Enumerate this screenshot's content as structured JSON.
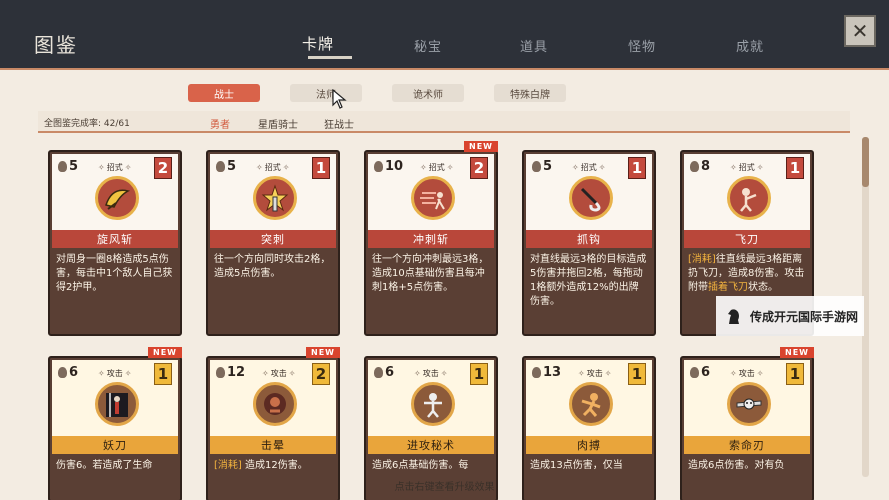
{
  "header": {
    "title": "图鉴",
    "tabs": [
      {
        "label": "卡牌",
        "active": true
      },
      {
        "label": "秘宝",
        "active": false
      },
      {
        "label": "道具",
        "active": false
      },
      {
        "label": "怪物",
        "active": false
      },
      {
        "label": "成就",
        "active": false
      }
    ],
    "close_label": "✕"
  },
  "class_tabs": [
    {
      "label": "战士",
      "active": true
    },
    {
      "label": "法师",
      "active": false
    },
    {
      "label": "诡术师",
      "active": false
    },
    {
      "label": "特殊白牌",
      "active": false
    }
  ],
  "progress": {
    "text": "全图鉴完成率: 42/61",
    "sub_tabs": [
      {
        "label": "勇者",
        "active": true
      },
      {
        "label": "星盾骑士",
        "active": false
      },
      {
        "label": "狂战士",
        "active": false
      }
    ]
  },
  "cards_row1": [
    {
      "cost": "5",
      "type": "招式",
      "level": "2",
      "name": "旋风斩",
      "desc": "对周身一圈8格造成5点伤害，每击中1个敌人自己获得2护甲。",
      "is_new": false,
      "new_label": "",
      "icon": "whirlwind-icon"
    },
    {
      "cost": "5",
      "type": "招式",
      "level": "1",
      "name": "突刺",
      "desc": "往一个方向同时攻击2格，造成5点伤害。",
      "is_new": false,
      "new_label": "",
      "icon": "thrust-icon"
    },
    {
      "cost": "10",
      "type": "招式",
      "level": "2",
      "name": "冲刺斩",
      "desc": "往一个方向冲刺最远3格，造成10点基础伤害且每冲刺1格+5点伤害。",
      "is_new": true,
      "new_label": "NEW",
      "icon": "dash-slash-icon"
    },
    {
      "cost": "5",
      "type": "招式",
      "level": "1",
      "name": "抓钩",
      "desc": "对直线最远3格的目标造成5伤害并拖回2格，每拖动1格额外造成12%的出牌伤害。",
      "is_new": false,
      "new_label": "",
      "icon": "hook-icon"
    },
    {
      "cost": "8",
      "type": "招式",
      "level": "1",
      "name": "飞刀",
      "desc_kw": "[消耗]",
      "desc": "往直线最远3格距离扔飞刀，造成8伤害。攻击附带",
      "desc_hl": "插着飞刀",
      "desc_tail": "状态。",
      "is_new": false,
      "new_label": "",
      "icon": "flying-knife-icon"
    }
  ],
  "cards_row2": [
    {
      "cost": "6",
      "type": "攻击",
      "level": "1",
      "name": "妖刀",
      "desc": "伤害6。若造成了生命",
      "is_new": true,
      "new_label": "NEW",
      "icon": "demon-blade-icon"
    },
    {
      "cost": "12",
      "type": "攻击",
      "level": "2",
      "name": "击晕",
      "desc_kw": "[消耗]",
      "desc": "造成12伤害。",
      "is_new": true,
      "new_label": "NEW",
      "icon": "stun-icon"
    },
    {
      "cost": "6",
      "type": "攻击",
      "level": "1",
      "name": "进攻秘术",
      "desc": "造成6点基础伤害。每",
      "is_new": false,
      "new_label": "",
      "icon": "offense-arcana-icon"
    },
    {
      "cost": "13",
      "type": "攻击",
      "level": "1",
      "name": "肉搏",
      "desc": "造成13点伤害，仅当",
      "is_new": false,
      "new_label": "",
      "icon": "brawl-icon"
    },
    {
      "cost": "6",
      "type": "攻击",
      "level": "1",
      "name": "索命刃",
      "desc": "造成6点伤害。对有负",
      "is_new": true,
      "new_label": "NEW",
      "icon": "death-blade-icon"
    }
  ],
  "footer_hint": "点击右键查看升级效果",
  "watermark": "传成开元国际手游网",
  "colors": {
    "accent": "#d9634a",
    "card_bg": "#5a3f34",
    "attack_gold": "#e9a53b",
    "skill_red": "#b9473a"
  }
}
